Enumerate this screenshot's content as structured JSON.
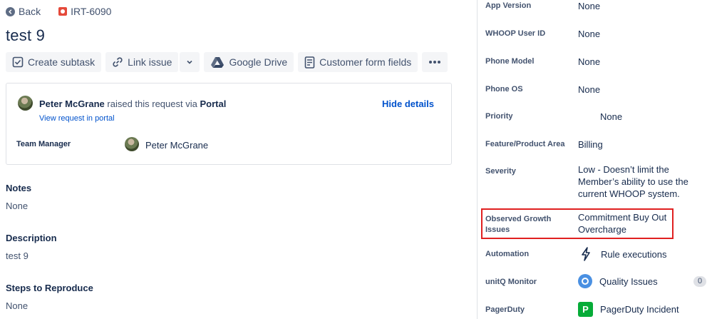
{
  "header": {
    "back_label": "Back",
    "issue_key": "IRT-6090",
    "title": "test 9"
  },
  "toolbar": {
    "create_subtask": "Create subtask",
    "link_issue": "Link issue",
    "google_drive": "Google Drive",
    "customer_form_fields": "Customer form fields"
  },
  "request": {
    "raiser_name": "Peter McGrane",
    "raised_text": "raised this request via",
    "channel": "Portal",
    "view_link": "View request in portal",
    "hide_details": "Hide details",
    "team_manager_label": "Team Manager",
    "team_manager_name": "Peter McGrane"
  },
  "sections": {
    "notes_label": "Notes",
    "notes_value": "None",
    "description_label": "Description",
    "description_value": "test 9",
    "steps_label": "Steps to Reproduce",
    "steps_value": "None"
  },
  "fields": {
    "app_version": {
      "label": "App Version",
      "value": "None"
    },
    "whoop_user_id": {
      "label": "WHOOP User ID",
      "value": "None"
    },
    "phone_model": {
      "label": "Phone Model",
      "value": "None"
    },
    "phone_os": {
      "label": "Phone OS",
      "value": "None"
    },
    "priority": {
      "label": "Priority",
      "value": "None"
    },
    "feature_area": {
      "label": "Feature/Product Area",
      "value": "Billing"
    },
    "severity": {
      "label": "Severity",
      "value_lines": [
        "Low - Doesn’t limit the",
        "Member’s ability to use the",
        "current WHOOP system."
      ]
    },
    "observed_growth": {
      "label_lines": [
        "Observed Growth",
        "Issues"
      ],
      "value_lines": [
        "Commitment Buy Out",
        "Overcharge"
      ]
    },
    "automation": {
      "label": "Automation",
      "value": "Rule executions",
      "icon": "lightning-icon"
    },
    "unitq": {
      "label": "unitQ Monitor",
      "value": "Quality Issues",
      "count": "0",
      "icon": "unitq-icon"
    },
    "pagerduty": {
      "label": "PagerDuty",
      "value": "PagerDuty Incident",
      "icon": "pagerduty-icon",
      "icon_letter": "P"
    }
  },
  "colors": {
    "link": "#0052cc",
    "highlight_border": "#e02020",
    "issue_type": "#e5493a",
    "pagerduty": "#06ac38",
    "unitq": "#4a90e2"
  }
}
